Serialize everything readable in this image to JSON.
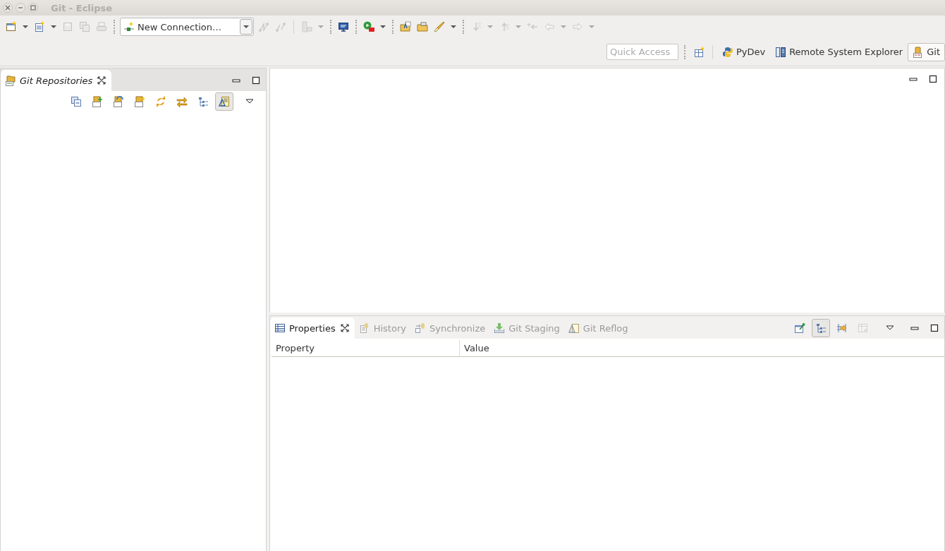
{
  "window": {
    "title": "Git - Eclipse"
  },
  "main_toolbar": [
    {
      "kind": "button",
      "disabled": false,
      "menu": true
    },
    {
      "kind": "button",
      "disabled": false,
      "menu": true
    },
    {
      "kind": "button",
      "disabled": true,
      "menu": false
    },
    {
      "kind": "button",
      "disabled": true,
      "menu": false
    },
    {
      "kind": "button",
      "disabled": true,
      "menu": false
    },
    {
      "kind": "gripper"
    },
    {
      "kind": "combo",
      "value": "New Connection…"
    },
    {
      "kind": "button",
      "disabled": true,
      "menu": false
    },
    {
      "kind": "button",
      "disabled": true,
      "menu": false
    },
    {
      "kind": "line"
    },
    {
      "kind": "button",
      "disabled": true,
      "menu": true
    },
    {
      "kind": "gripper"
    },
    {
      "kind": "button",
      "disabled": false,
      "menu": false
    },
    {
      "kind": "gripper"
    },
    {
      "kind": "button",
      "disabled": false,
      "menu": true
    },
    {
      "kind": "gripper"
    },
    {
      "kind": "button",
      "disabled": false,
      "menu": false
    },
    {
      "kind": "button",
      "disabled": false,
      "menu": false
    },
    {
      "kind": "button",
      "disabled": false,
      "menu": true
    },
    {
      "kind": "gripper"
    },
    {
      "kind": "button",
      "disabled": true,
      "menu": true
    },
    {
      "kind": "button",
      "disabled": true,
      "menu": true
    },
    {
      "kind": "button",
      "disabled": true,
      "menu": false
    },
    {
      "kind": "button",
      "disabled": true,
      "menu": true
    },
    {
      "kind": "button",
      "disabled": true,
      "menu": true
    }
  ],
  "shortcut_bar": {
    "quick_access": {
      "placeholder": "Quick Access"
    },
    "perspectives": [
      {
        "label": "PyDev",
        "selected": false
      },
      {
        "label": "Remote System Explorer",
        "selected": false
      },
      {
        "label": "Git",
        "selected": true
      }
    ]
  },
  "repositories_view": {
    "tabs": [
      {
        "label": "Git Repositories",
        "selected": true
      }
    ],
    "toolbar": [
      {
        "on": false
      },
      {
        "on": false
      },
      {
        "on": false
      },
      {
        "on": false
      },
      {
        "on": false
      },
      {
        "on": false
      },
      {
        "on": false
      },
      {
        "on": true
      }
    ]
  },
  "properties_view": {
    "tabs": [
      {
        "label": "Properties",
        "selected": true
      },
      {
        "label": "History",
        "selected": false
      },
      {
        "label": "Synchronize",
        "selected": false
      },
      {
        "label": "Git Staging",
        "selected": false
      },
      {
        "label": "Git Reflog",
        "selected": false
      }
    ],
    "toolbar": [
      {
        "on": false,
        "disabled": false
      },
      {
        "on": true,
        "disabled": false
      },
      {
        "on": false,
        "disabled": false
      },
      {
        "on": false,
        "disabled": true
      }
    ],
    "columns": [
      "Property",
      "Value"
    ]
  }
}
